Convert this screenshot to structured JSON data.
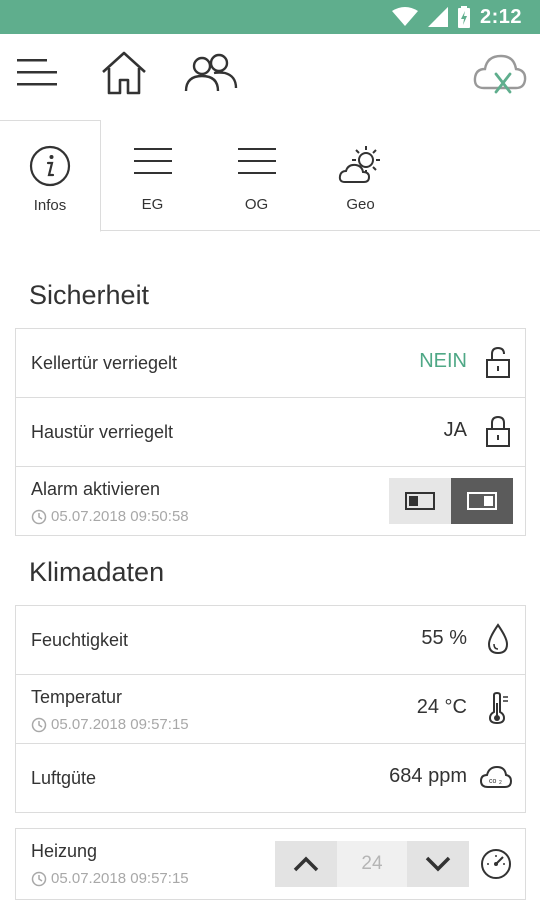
{
  "status_bar": {
    "time": "2:12",
    "battery_icon": "battery-charging-icon",
    "wifi_icon": "wifi-icon",
    "signal_icon": "signal-icon"
  },
  "brand_color": "#5fae8d",
  "toolbar": {
    "menu_icon": "menu-icon",
    "home_icon": "home-icon",
    "users_icon": "users-icon",
    "cloud_icon": "cloud-disconnected-icon"
  },
  "tabs": [
    {
      "label": "Infos",
      "icon": "info-icon",
      "active": true
    },
    {
      "label": "EG",
      "icon": "floor-icon",
      "active": false
    },
    {
      "label": "OG",
      "icon": "floor-icon",
      "active": false
    },
    {
      "label": "Geo",
      "icon": "weather-icon",
      "active": false
    }
  ],
  "sicherheit": {
    "title": "Sicherheit",
    "rows": [
      {
        "label": "Kellertür verriegelt",
        "value": "NEIN",
        "icon": "unlocked-icon"
      },
      {
        "label": "Haustür verriegelt",
        "value": "JA",
        "icon": "lock-icon"
      },
      {
        "label": "Alarm aktivieren",
        "timestamp": "05.07.2018 09:50:58",
        "state": "on"
      }
    ]
  },
  "klimadaten": {
    "title": "Klimadaten",
    "rows": [
      {
        "label": "Feuchtigkeit",
        "value": "55 %",
        "icon": "drop-icon"
      },
      {
        "label": "Temperatur",
        "timestamp": "05.07.2018 09:57:15",
        "value": "24 °C",
        "icon": "thermometer-icon"
      },
      {
        "label": "Luftgüte",
        "value": "684 ppm",
        "icon": "co2-icon"
      }
    ]
  },
  "heizung": {
    "label": "Heizung",
    "timestamp": "05.07.2018 09:57:15",
    "value": "24",
    "icon": "gauge-icon"
  }
}
